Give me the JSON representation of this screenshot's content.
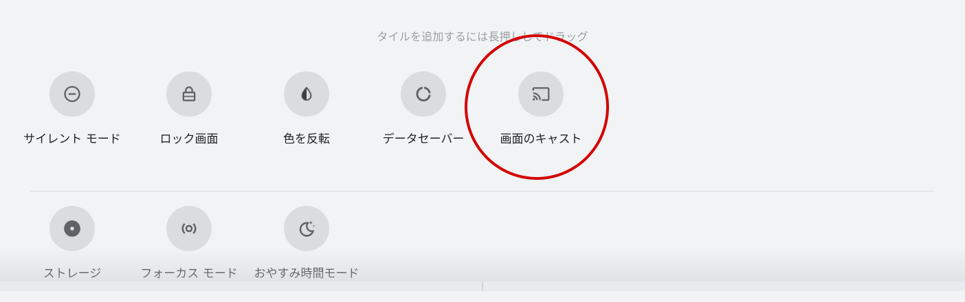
{
  "header": {
    "hint": "タイルを追加するには長押ししてドラッグ"
  },
  "tiles_active": [
    {
      "id": "silent-mode",
      "label": "サイレント モード",
      "icon": "do-not-disturb-icon"
    },
    {
      "id": "lock-screen",
      "label": "ロック画面",
      "icon": "lock-icon"
    },
    {
      "id": "invert-colors",
      "label": "色を反転",
      "icon": "invert-colors-icon"
    },
    {
      "id": "data-saver",
      "label": "データセーバー",
      "icon": "data-saver-icon"
    },
    {
      "id": "screen-cast",
      "label": "画面のキャスト",
      "icon": "cast-icon"
    }
  ],
  "tiles_available": [
    {
      "id": "storage",
      "label": "ストレージ",
      "icon": "storage-icon"
    },
    {
      "id": "focus-mode",
      "label": "フォーカス モード",
      "icon": "focus-mode-icon"
    },
    {
      "id": "bedtime-mode",
      "label": "おやすみ時間モード",
      "icon": "bedtime-moon-icon"
    }
  ],
  "colors": {
    "background": "#f1f3f4",
    "tile_circle": "#dadce0",
    "icon": "#5f6368",
    "highlight": "#d40000"
  }
}
